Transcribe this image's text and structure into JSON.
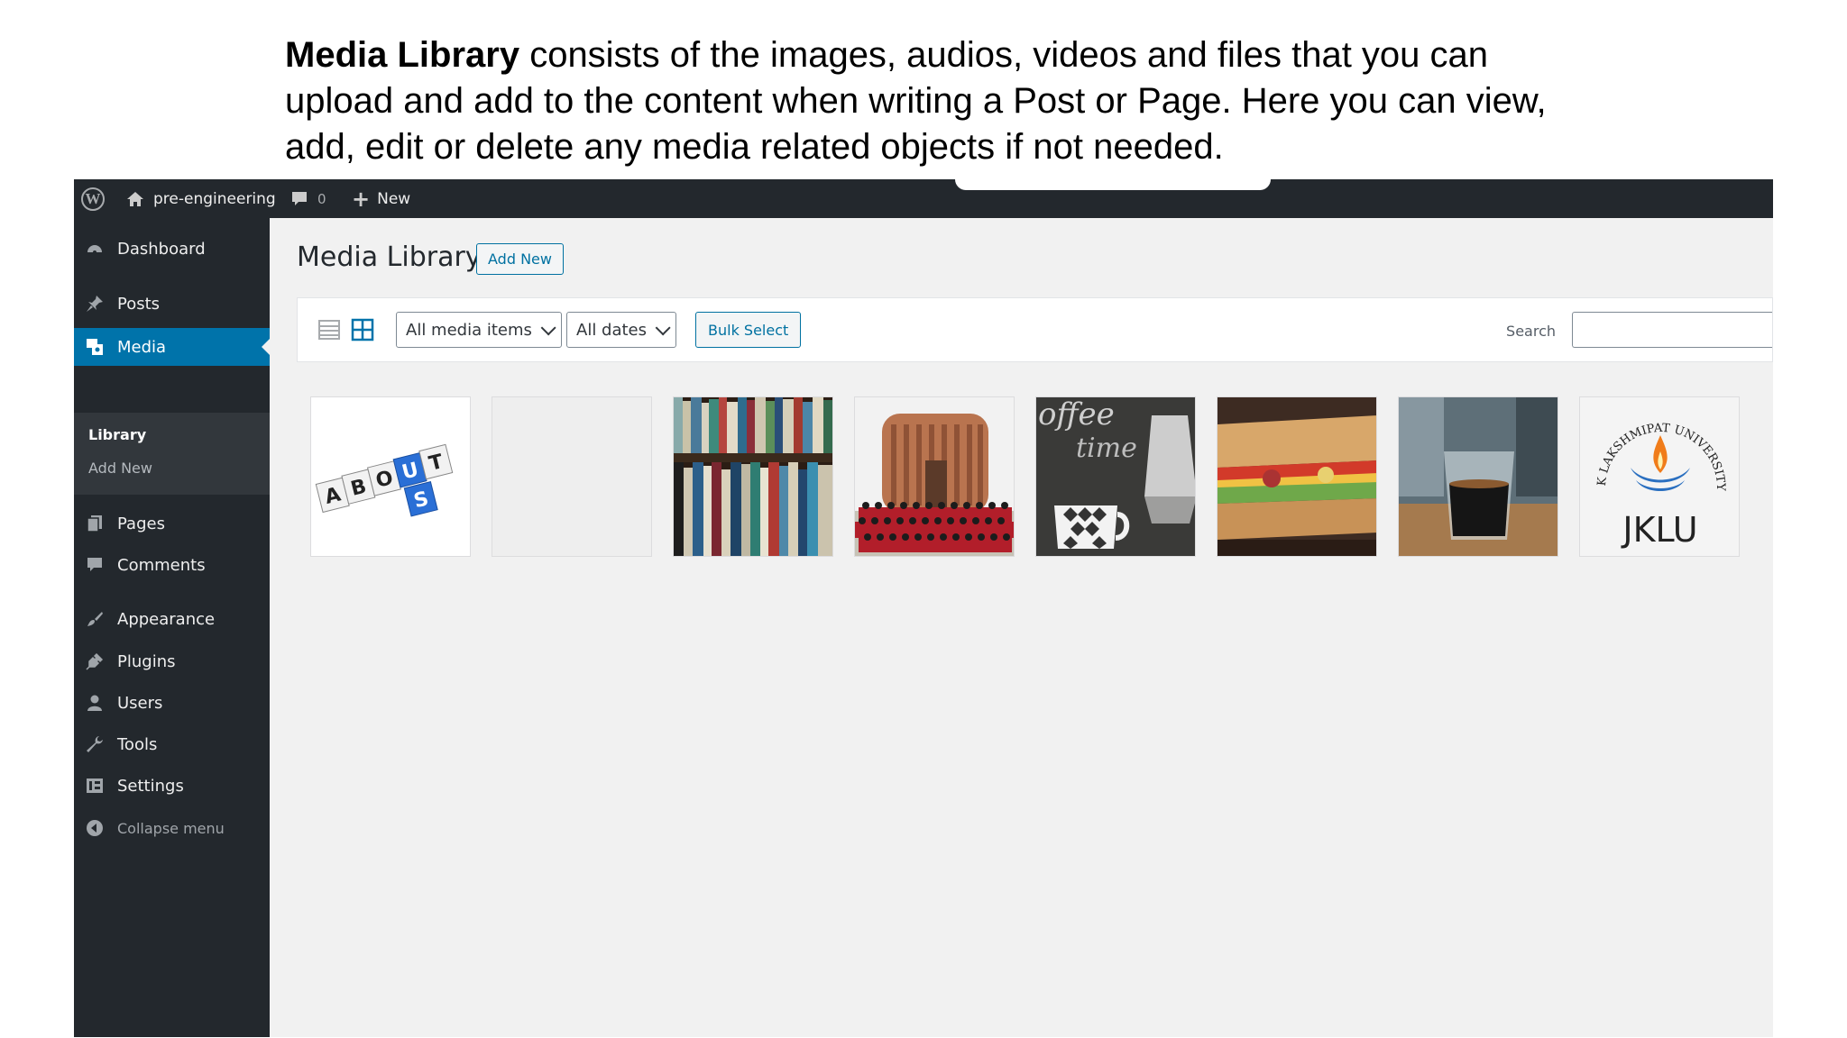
{
  "caption": {
    "bold": "Media Library",
    "rest": " consists of the images, audios, videos and files that you can upload and add to the content when writing a Post or Page. Here you can view, add, edit or delete any media related objects if not needed."
  },
  "adminbar": {
    "site_name": "pre-engineering",
    "comments_count": "0",
    "new_label": "New"
  },
  "sidebar": {
    "dashboard": "Dashboard",
    "posts": "Posts",
    "media": "Media",
    "library": "Library",
    "add_new": "Add New",
    "pages": "Pages",
    "comments": "Comments",
    "appearance": "Appearance",
    "plugins": "Plugins",
    "users": "Users",
    "tools": "Tools",
    "settings": "Settings",
    "collapse": "Collapse menu"
  },
  "main": {
    "title": "Media Library",
    "add_new": "Add New",
    "filter_type": "All media items",
    "filter_date": "All dates",
    "bulk_select": "Bulk Select",
    "search_label": "Search"
  },
  "media_items": [
    {
      "name": "about-us-blocks",
      "letters": "ABOUT US"
    },
    {
      "name": "blank-placeholder"
    },
    {
      "name": "bookshelf"
    },
    {
      "name": "campus-group-photo"
    },
    {
      "name": "coffee-time-chalkboard",
      "text": "offee time"
    },
    {
      "name": "sandwich"
    },
    {
      "name": "espresso-glass"
    },
    {
      "name": "jklu-logo",
      "arc_text": "JK LAKSHMIPAT UNIVERSITY",
      "brand": "JKLU"
    }
  ],
  "colors": {
    "admin_dark": "#23282d",
    "active_blue": "#0073aa",
    "link_blue": "#0071a1",
    "background": "#f1f1f1"
  }
}
